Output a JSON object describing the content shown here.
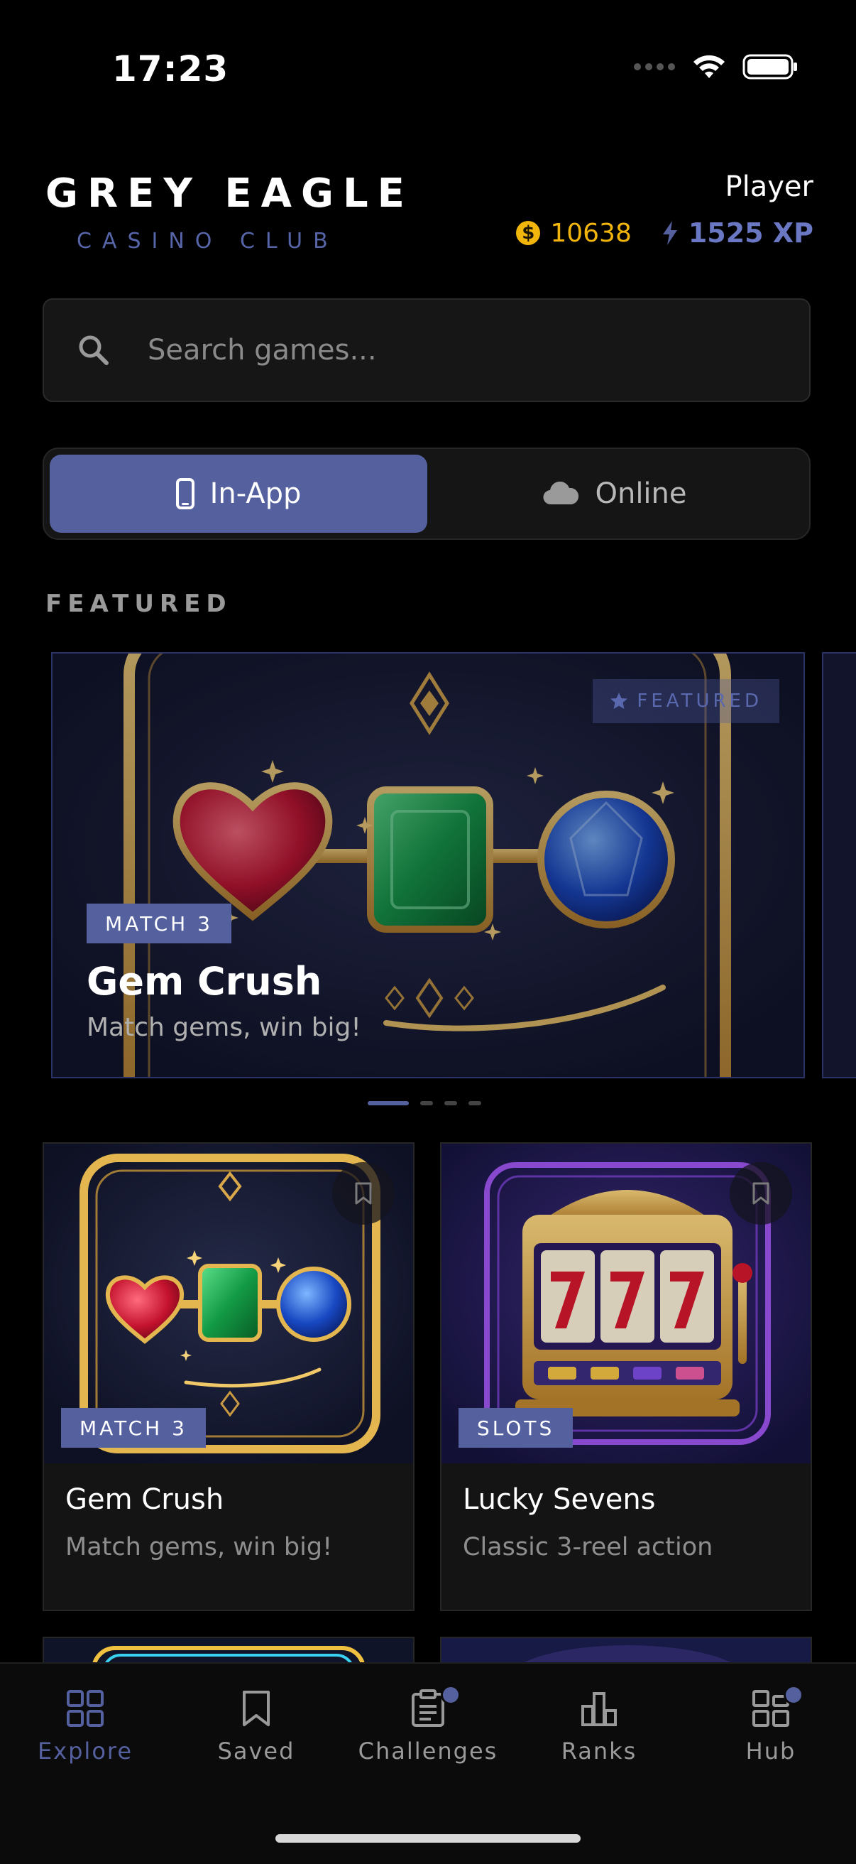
{
  "status": {
    "time": "17:23"
  },
  "header": {
    "brand_title": "GREY EAGLE",
    "brand_subtitle": "CASINO CLUB",
    "player_name": "Player",
    "coins": "10638",
    "coin_symbol": "$",
    "xp": "1525 XP"
  },
  "search": {
    "placeholder": "Search games..."
  },
  "segments": [
    {
      "label": "In-App",
      "icon": "phone-icon",
      "active": true
    },
    {
      "label": "Online",
      "icon": "cloud-icon",
      "active": false
    }
  ],
  "featured": {
    "section_label": "FEATURED",
    "badge": "FEATURED",
    "tag": "MATCH 3",
    "title": "Gem Crush",
    "subtitle": "Match gems, win big!"
  },
  "games": [
    {
      "tag": "MATCH 3",
      "title": "Gem Crush",
      "subtitle": "Match gems, win big!"
    },
    {
      "tag": "SLOTS",
      "title": "Lucky Sevens",
      "subtitle": "Classic 3-reel action"
    }
  ],
  "tabs": [
    {
      "label": "Explore",
      "icon": "grid-icon",
      "active": true,
      "notify": false
    },
    {
      "label": "Saved",
      "icon": "bookmark-icon",
      "active": false,
      "notify": false
    },
    {
      "label": "Challenges",
      "icon": "clipboard-icon",
      "active": false,
      "notify": true
    },
    {
      "label": "Ranks",
      "icon": "bar-chart-icon",
      "active": false,
      "notify": false
    },
    {
      "label": "Hub",
      "icon": "hub-icon",
      "active": false,
      "notify": true
    }
  ],
  "colors": {
    "accent": "#55609f",
    "coin": "#f2b50c",
    "background": "#000000"
  }
}
